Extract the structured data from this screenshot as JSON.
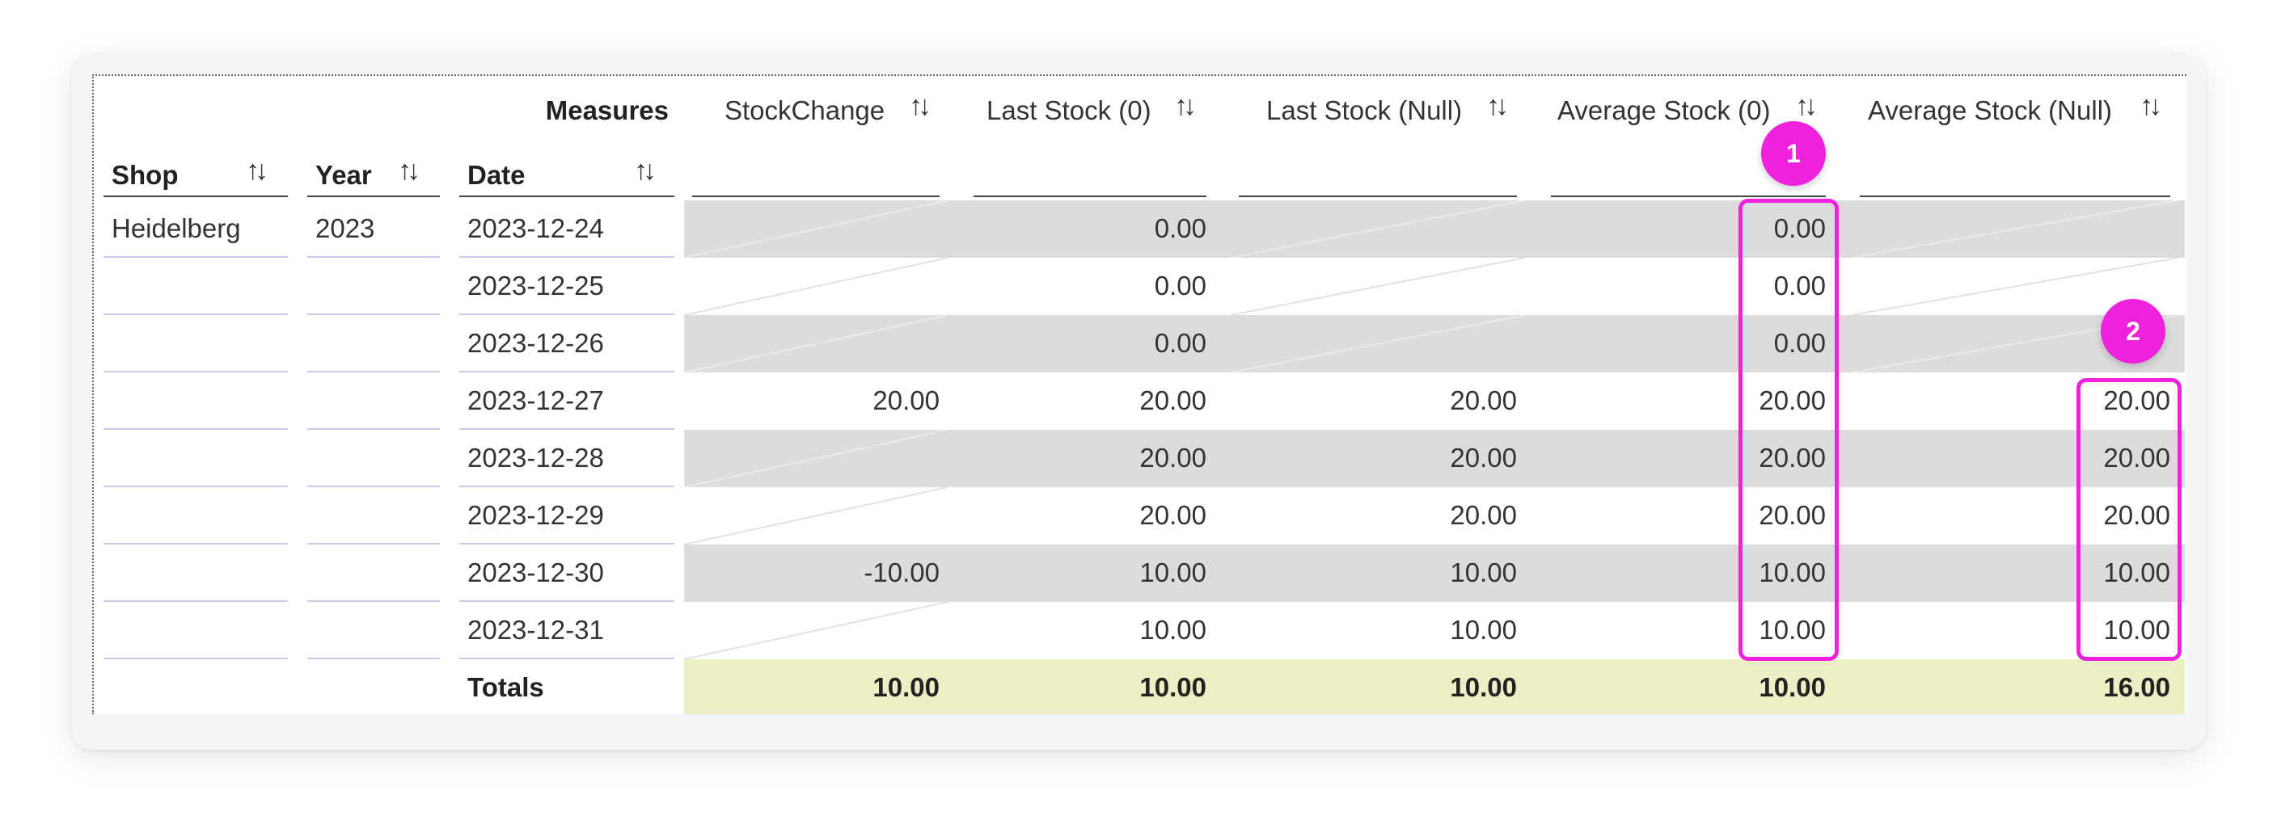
{
  "measures_label": "Measures",
  "row_headers": [
    "Shop",
    "Year",
    "Date"
  ],
  "columns": [
    "StockChange",
    "Last Stock (0)",
    "Last Stock (Null)",
    "Average Stock (0)",
    "Average Stock (Null)"
  ],
  "rows": [
    {
      "shop": "Heidelberg",
      "year": "2023",
      "date": "2023-12-24",
      "values": [
        "",
        "0.00",
        "",
        "0.00",
        ""
      ]
    },
    {
      "shop": "",
      "year": "",
      "date": "2023-12-25",
      "values": [
        "",
        "0.00",
        "",
        "0.00",
        ""
      ]
    },
    {
      "shop": "",
      "year": "",
      "date": "2023-12-26",
      "values": [
        "",
        "0.00",
        "",
        "0.00",
        ""
      ]
    },
    {
      "shop": "",
      "year": "",
      "date": "2023-12-27",
      "values": [
        "20.00",
        "20.00",
        "20.00",
        "20.00",
        "20.00"
      ]
    },
    {
      "shop": "",
      "year": "",
      "date": "2023-12-28",
      "values": [
        "",
        "20.00",
        "20.00",
        "20.00",
        "20.00"
      ]
    },
    {
      "shop": "",
      "year": "",
      "date": "2023-12-29",
      "values": [
        "",
        "20.00",
        "20.00",
        "20.00",
        "20.00"
      ]
    },
    {
      "shop": "",
      "year": "",
      "date": "2023-12-30",
      "values": [
        "-10.00",
        "10.00",
        "10.00",
        "10.00",
        "10.00"
      ]
    },
    {
      "shop": "",
      "year": "",
      "date": "2023-12-31",
      "values": [
        "",
        "10.00",
        "10.00",
        "10.00",
        "10.00"
      ]
    }
  ],
  "totals": {
    "label": "Totals",
    "values": [
      "10.00",
      "10.00",
      "10.00",
      "10.00",
      "16.00"
    ]
  },
  "annotations": [
    "1",
    "2"
  ],
  "colors": {
    "highlight": "#ee22dd",
    "shaded_row": "#dcdcde",
    "totals_row": "#eeeec4",
    "row_line": "#c9c9ee"
  }
}
